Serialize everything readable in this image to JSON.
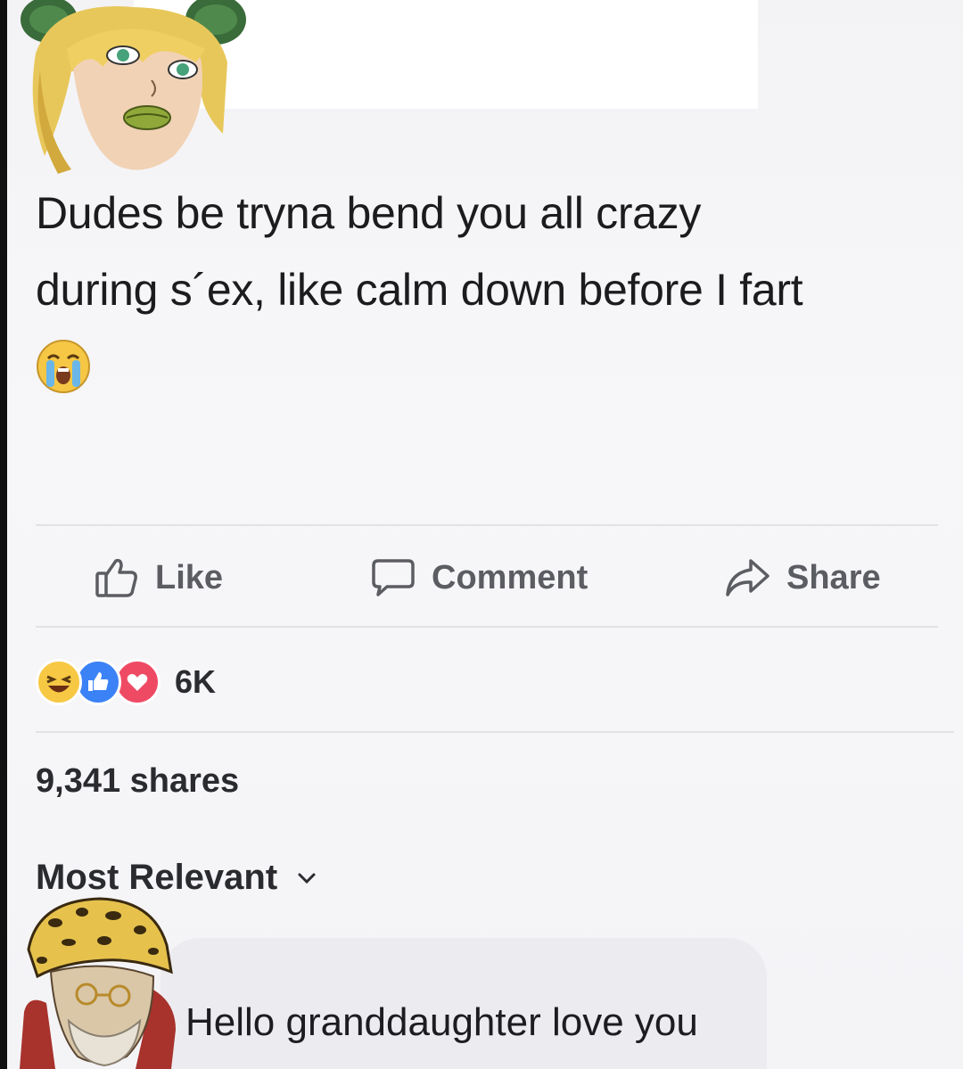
{
  "post": {
    "line1": "Dudes be tryna bend you all crazy",
    "line2": "during s´ex, like calm down before I fart",
    "emoji": "crying-face-emoji"
  },
  "actions": {
    "like_label": "Like",
    "comment_label": "Comment",
    "share_label": "Share"
  },
  "reactions": {
    "icons": [
      "haha-reaction-icon",
      "like-reaction-icon",
      "love-reaction-icon"
    ],
    "count": "6K"
  },
  "shares": {
    "text": "9,341 shares"
  },
  "comments": {
    "sort_label": "Most Relevant",
    "items": [
      {
        "text": "Hello granddaughter love you"
      }
    ]
  },
  "colors": {
    "text_dark": "#1c1c1e",
    "action_gray": "#5b5d62",
    "bubble_bg": "#ececf0",
    "like_blue": "#3b82f6",
    "love_red": "#ef4a64",
    "haha_yellow": "#f7c843"
  }
}
